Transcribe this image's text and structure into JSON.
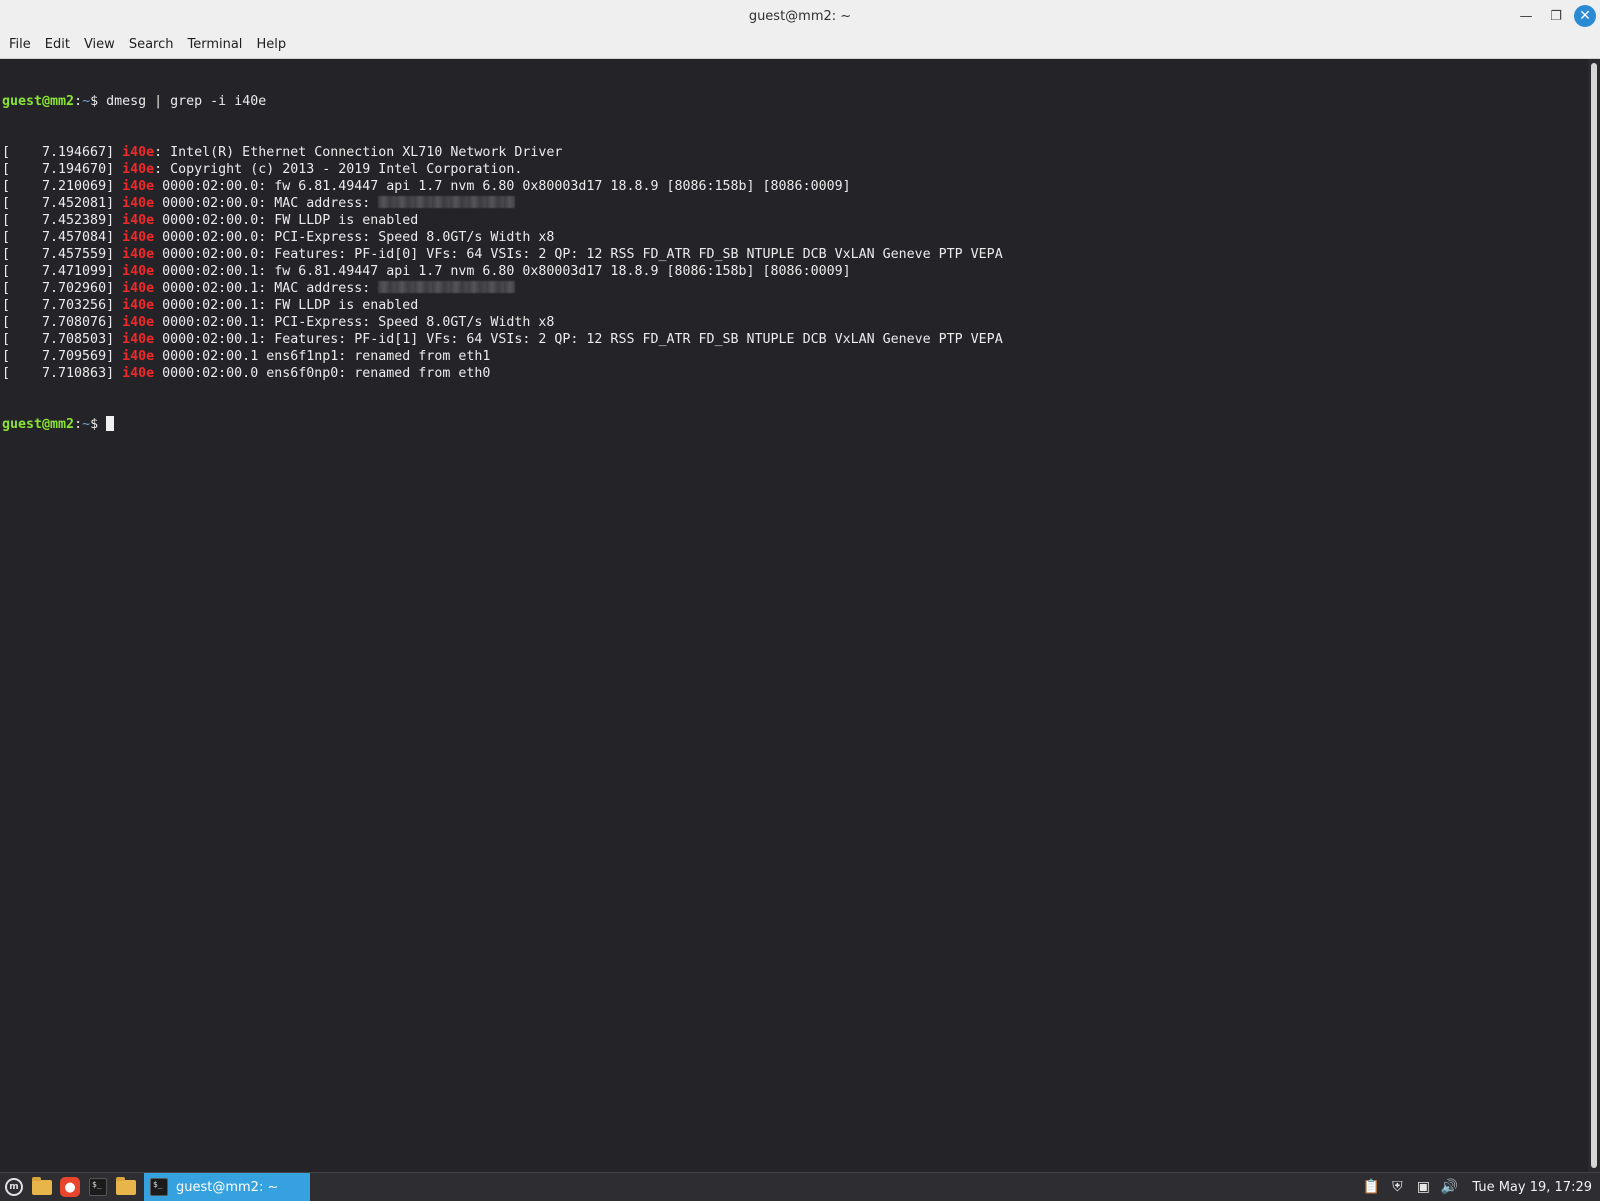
{
  "window": {
    "title": "guest@mm2: ~"
  },
  "menubar": {
    "items": [
      "File",
      "Edit",
      "View",
      "Search",
      "Terminal",
      "Help"
    ]
  },
  "terminal": {
    "prompt_user": "guest@mm2",
    "prompt_sep": ":",
    "prompt_path": "~",
    "prompt_sym": "$ ",
    "command": "dmesg | grep -i i40e",
    "match": "i40e",
    "lines": [
      {
        "ts": "[    7.194667] ",
        "tag": "i40e",
        "text": ": Intel(R) Ethernet Connection XL710 Network Driver"
      },
      {
        "ts": "[    7.194670] ",
        "tag": "i40e",
        "text": ": Copyright (c) 2013 - 2019 Intel Corporation."
      },
      {
        "ts": "[    7.210069] ",
        "tag": "i40e",
        "text": " 0000:02:00.0: fw 6.81.49447 api 1.7 nvm 6.80 0x80003d17 18.8.9 [8086:158b] [8086:0009]"
      },
      {
        "ts": "[    7.452081] ",
        "tag": "i40e",
        "text": " 0000:02:00.0: MAC address: ",
        "redacted": true
      },
      {
        "ts": "[    7.452389] ",
        "tag": "i40e",
        "text": " 0000:02:00.0: FW LLDP is enabled"
      },
      {
        "ts": "[    7.457084] ",
        "tag": "i40e",
        "text": " 0000:02:00.0: PCI-Express: Speed 8.0GT/s Width x8"
      },
      {
        "ts": "[    7.457559] ",
        "tag": "i40e",
        "text": " 0000:02:00.0: Features: PF-id[0] VFs: 64 VSIs: 2 QP: 12 RSS FD_ATR FD_SB NTUPLE DCB VxLAN Geneve PTP VEPA"
      },
      {
        "ts": "[    7.471099] ",
        "tag": "i40e",
        "text": " 0000:02:00.1: fw 6.81.49447 api 1.7 nvm 6.80 0x80003d17 18.8.9 [8086:158b] [8086:0009]"
      },
      {
        "ts": "[    7.702960] ",
        "tag": "i40e",
        "text": " 0000:02:00.1: MAC address: ",
        "redacted": true
      },
      {
        "ts": "[    7.703256] ",
        "tag": "i40e",
        "text": " 0000:02:00.1: FW LLDP is enabled"
      },
      {
        "ts": "[    7.708076] ",
        "tag": "i40e",
        "text": " 0000:02:00.1: PCI-Express: Speed 8.0GT/s Width x8"
      },
      {
        "ts": "[    7.708503] ",
        "tag": "i40e",
        "text": " 0000:02:00.1: Features: PF-id[1] VFs: 64 VSIs: 2 QP: 12 RSS FD_ATR FD_SB NTUPLE DCB VxLAN Geneve PTP VEPA"
      },
      {
        "ts": "[    7.709569] ",
        "tag": "i40e",
        "text": " 0000:02:00.1 ens6f1np1: renamed from eth1"
      },
      {
        "ts": "[    7.710863] ",
        "tag": "i40e",
        "text": " 0000:02:00.0 ens6f0np0: renamed from eth0"
      }
    ]
  },
  "taskbar": {
    "task_label": "guest@mm2: ~",
    "clock": "Tue May 19, 17:29"
  },
  "colors": {
    "prompt_user": "#8ae234",
    "prompt_path": "#729fcf",
    "grep_match": "#ef2929",
    "task_active": "#35a1de"
  }
}
